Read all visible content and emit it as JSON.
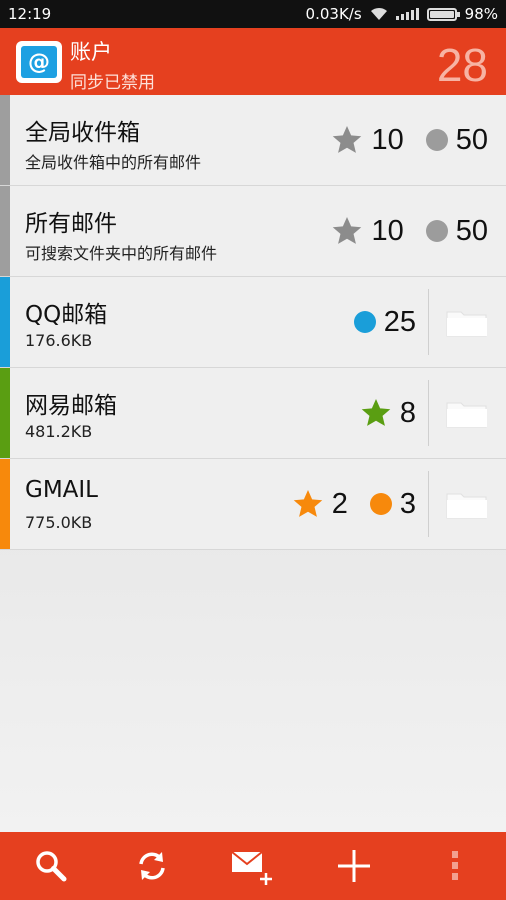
{
  "status": {
    "time": "12:19",
    "speed": "0.03K/s",
    "battery": "98%"
  },
  "header": {
    "title": "账户",
    "subtitle": "同步已禁用",
    "count": "28",
    "icon": "mail-at-icon"
  },
  "accent": {
    "bar": "#e5401f",
    "grey": "#9e9e9e",
    "qq": "#1a9ed9",
    "netease": "#5a9e12",
    "gmail": "#f7890c"
  },
  "items": [
    {
      "name": "全局收件箱",
      "sub": "全局收件箱中的所有邮件",
      "star": "10",
      "dot": "50"
    },
    {
      "name": "所有邮件",
      "sub": "可搜索文件夹中的所有邮件",
      "star": "10",
      "dot": "50"
    },
    {
      "name": "QQ邮箱",
      "sub": "176.6KB",
      "dot": "25"
    },
    {
      "name": "网易邮箱",
      "sub": "481.2KB",
      "star": "8"
    },
    {
      "name": "GMAIL",
      "sub": "775.0KB",
      "star": "2",
      "dot": "3"
    }
  ],
  "toolbar": [
    "search-icon",
    "refresh-icon",
    "compose-icon",
    "add-icon",
    "overflow-menu-icon"
  ]
}
